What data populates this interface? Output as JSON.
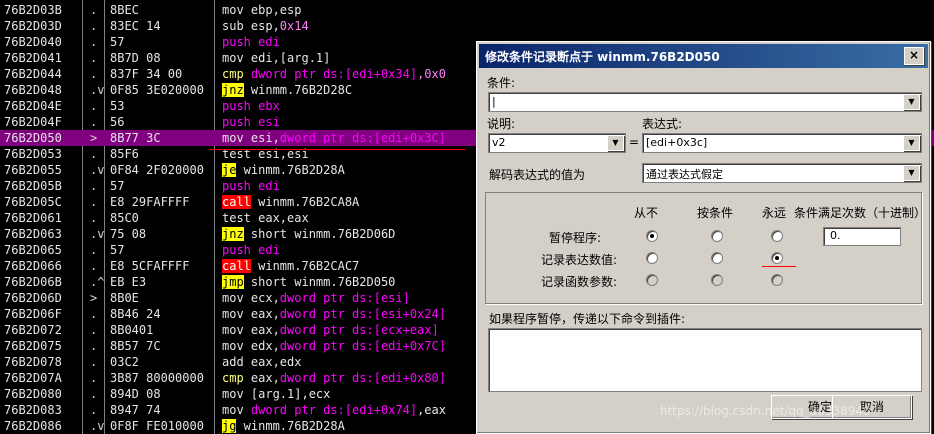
{
  "disasm": {
    "rows": [
      {
        "addr": "76B2D03B",
        "mark": ".",
        "hex": "8BEC",
        "ins": [
          {
            "t": "mov ebp,esp",
            "c": ""
          }
        ]
      },
      {
        "addr": "76B2D03D",
        "mark": ".",
        "hex": "83EC 14",
        "ins": [
          {
            "t": "sub esp,",
            "c": ""
          },
          {
            "t": "0x14",
            "c": "op-imm"
          }
        ]
      },
      {
        "addr": "76B2D040",
        "mark": ".",
        "hex": "57",
        "ins": [
          {
            "t": "push edi",
            "c": "m-push"
          }
        ]
      },
      {
        "addr": "76B2D041",
        "mark": ".",
        "hex": "8B7D 08",
        "ins": [
          {
            "t": "mov edi,[arg.1]",
            "c": ""
          }
        ]
      },
      {
        "addr": "76B2D044",
        "mark": ".",
        "hex": "837F 34 00",
        "ins": [
          {
            "t": "cmp ",
            "c": "m-cmp"
          },
          {
            "t": "dword ptr ds:[edi+0x34]",
            "c": "op-mem"
          },
          {
            "t": ",0x0",
            "c": "op-imm"
          }
        ]
      },
      {
        "addr": "76B2D048",
        "mark": ".v",
        "hex": "0F85 3E020000",
        "ins": [
          {
            "t": "jnz",
            "c": "m-jcc"
          },
          {
            "t": " winmm.76B2D28C",
            "c": ""
          }
        ]
      },
      {
        "addr": "76B2D04E",
        "mark": ".",
        "hex": "53",
        "ins": [
          {
            "t": "push ebx",
            "c": "m-push"
          }
        ]
      },
      {
        "addr": "76B2D04F",
        "mark": ".",
        "hex": "56",
        "ins": [
          {
            "t": "push esi",
            "c": "m-push"
          }
        ]
      },
      {
        "addr": "76B2D050",
        "mark": ">",
        "hex": "8B77 3C",
        "sel": true,
        "ins": [
          {
            "t": "mov esi,",
            "c": ""
          },
          {
            "t": "dword ptr ds:[edi+0x3C]",
            "c": "op-mem"
          }
        ]
      },
      {
        "addr": "76B2D053",
        "mark": ".",
        "hex": "85F6",
        "ins": [
          {
            "t": "test esi,esi",
            "c": ""
          }
        ]
      },
      {
        "addr": "76B2D055",
        "mark": ".v",
        "hex": "0F84 2F020000",
        "ins": [
          {
            "t": "je",
            "c": "m-jcc"
          },
          {
            "t": " winmm.76B2D28A",
            "c": ""
          }
        ]
      },
      {
        "addr": "76B2D05B",
        "mark": ".",
        "hex": "57",
        "ins": [
          {
            "t": "push edi",
            "c": "m-push"
          }
        ]
      },
      {
        "addr": "76B2D05C",
        "mark": ".",
        "hex": "E8 29FAFFFF",
        "ins": [
          {
            "t": "call",
            "c": "m-call"
          },
          {
            "t": " winmm.76B2CA8A",
            "c": ""
          }
        ]
      },
      {
        "addr": "76B2D061",
        "mark": ".",
        "hex": "85C0",
        "ins": [
          {
            "t": "test eax,eax",
            "c": ""
          }
        ]
      },
      {
        "addr": "76B2D063",
        "mark": ".v",
        "hex": "75 08",
        "ins": [
          {
            "t": "jnz",
            "c": "m-jcc"
          },
          {
            "t": " short winmm.76B2D06D",
            "c": ""
          }
        ]
      },
      {
        "addr": "76B2D065",
        "mark": ".",
        "hex": "57",
        "ins": [
          {
            "t": "push edi",
            "c": "m-push"
          }
        ]
      },
      {
        "addr": "76B2D066",
        "mark": ".",
        "hex": "E8 5CFAFFFF",
        "ins": [
          {
            "t": "call",
            "c": "m-call"
          },
          {
            "t": " winmm.76B2CAC7",
            "c": ""
          }
        ]
      },
      {
        "addr": "76B2D06B",
        "mark": ".^",
        "hex": "EB E3",
        "ins": [
          {
            "t": "jmp",
            "c": "m-jmp"
          },
          {
            "t": " short winmm.76B2D050",
            "c": ""
          }
        ]
      },
      {
        "addr": "76B2D06D",
        "mark": ">",
        "hex": "8B0E",
        "ins": [
          {
            "t": "mov ecx,",
            "c": ""
          },
          {
            "t": "dword ptr ds:[esi]",
            "c": "op-mem"
          }
        ]
      },
      {
        "addr": "76B2D06F",
        "mark": ".",
        "hex": "8B46 24",
        "ins": [
          {
            "t": "mov eax,",
            "c": ""
          },
          {
            "t": "dword ptr ds:[esi+0x24]",
            "c": "op-mem"
          }
        ]
      },
      {
        "addr": "76B2D072",
        "mark": ".",
        "hex": "8B0401",
        "ins": [
          {
            "t": "mov eax,",
            "c": ""
          },
          {
            "t": "dword ptr ds:[ecx+eax]",
            "c": "op-mem"
          }
        ]
      },
      {
        "addr": "76B2D075",
        "mark": ".",
        "hex": "8B57 7C",
        "ins": [
          {
            "t": "mov edx,",
            "c": ""
          },
          {
            "t": "dword ptr ds:[edi+0x7C]",
            "c": "op-mem"
          }
        ]
      },
      {
        "addr": "76B2D078",
        "mark": ".",
        "hex": "03C2",
        "ins": [
          {
            "t": "add eax,edx",
            "c": ""
          }
        ]
      },
      {
        "addr": "76B2D07A",
        "mark": ".",
        "hex": "3B87 80000000",
        "ins": [
          {
            "t": "cmp ",
            "c": "m-cmp"
          },
          {
            "t": "eax,",
            "c": ""
          },
          {
            "t": "dword ptr ds:[edi+0x80]",
            "c": "op-mem"
          }
        ]
      },
      {
        "addr": "76B2D080",
        "mark": ".",
        "hex": "894D 08",
        "ins": [
          {
            "t": "mov [arg.1],ecx",
            "c": ""
          }
        ]
      },
      {
        "addr": "76B2D083",
        "mark": ".",
        "hex": "8947 74",
        "ins": [
          {
            "t": "mov ",
            "c": ""
          },
          {
            "t": "dword ptr ds:[edi+0x74]",
            "c": "op-mem"
          },
          {
            "t": ",eax",
            "c": ""
          }
        ]
      },
      {
        "addr": "76B2D086",
        "mark": ".v",
        "hex": "0F8F FE010000",
        "ins": [
          {
            "t": "jg",
            "c": "m-jcc"
          },
          {
            "t": " winmm.76B2D28A",
            "c": ""
          }
        ]
      }
    ]
  },
  "dialog": {
    "title": "修改条件记录断点于 winmm.76B2D050",
    "close_label": "×",
    "condition_label": "条件:",
    "condition_value": "|",
    "desc_label": "说明:",
    "desc_value": "v2",
    "equals_label": "=",
    "expr_label": "表达式:",
    "expr_value": "[edi+0x3c]",
    "decode_label": "解码表达式的值为",
    "decode_value": "通过表达式假定",
    "cols": {
      "never": "从不",
      "on_cond": "按条件",
      "always": "永远",
      "count": "条件满足次数（十进制）"
    },
    "rows": {
      "pause": "暂停程序:",
      "log_expr": "记录表达数值:",
      "log_args": "记录函数参数:"
    },
    "count_value": "0.",
    "plugin_label": "如果程序暂停，传递以下命令到插件:",
    "ok_label": "确定",
    "cancel_label": "取消"
  },
  "watermark": "https://blog.csdn.net/qq_36338940"
}
